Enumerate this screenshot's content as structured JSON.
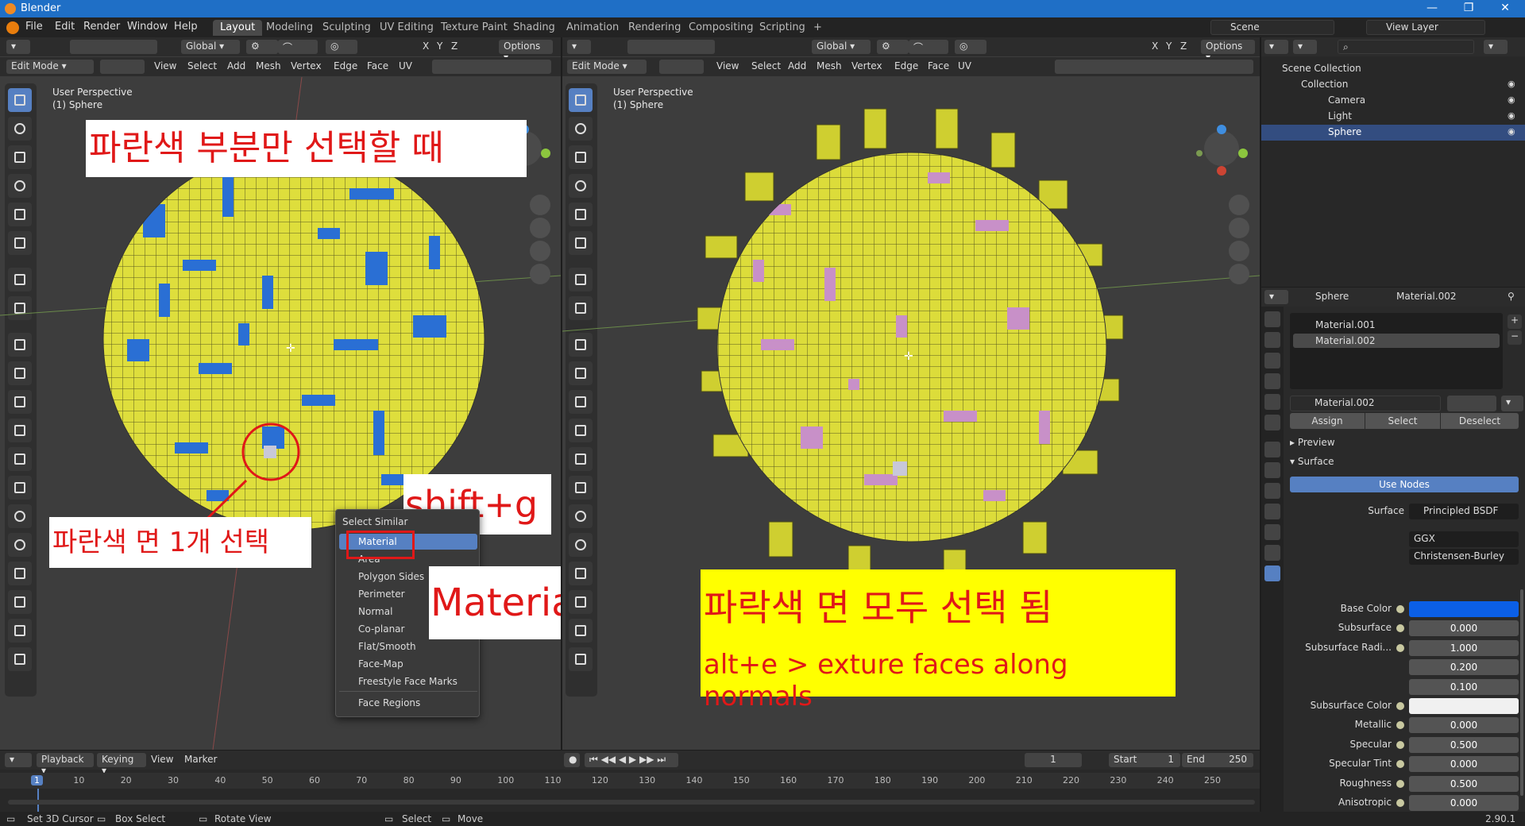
{
  "window": {
    "title": "Blender",
    "min": "—",
    "max": "❐",
    "close": "✕"
  },
  "menu": [
    "File",
    "Edit",
    "Render",
    "Window",
    "Help"
  ],
  "workspaces": [
    "Layout",
    "Modeling",
    "Sculpting",
    "UV Editing",
    "Texture Paint",
    "Shading",
    "Animation",
    "Rendering",
    "Compositing",
    "Scripting",
    "+"
  ],
  "scene": {
    "scene_name": "Scene",
    "view_layer": "View Layer"
  },
  "viewport_header": {
    "orientation": "Global",
    "options": "Options",
    "mode": "Edit Mode",
    "menus": [
      "View",
      "Select",
      "Add",
      "Mesh",
      "Vertex",
      "Edge",
      "Face",
      "UV"
    ],
    "axes": [
      "X",
      "Y",
      "Z"
    ]
  },
  "viewport_left": {
    "perspective": "User Perspective",
    "object": "(1) Sphere"
  },
  "viewport_right": {
    "perspective": "User Perspective",
    "object": "(1) Sphere"
  },
  "annotations": {
    "top_left": "파란색 부분만 선택할 때",
    "bottom_left": "파란색 면 1개 선택",
    "shortcut": "shift+g",
    "material": "Material",
    "result_line1": "파락색 면 모두 선택 됨",
    "result_line2": "alt+e > exture faces along normals"
  },
  "select_similar": {
    "title": "Select Similar",
    "items": [
      "Material",
      "Area",
      "Polygon Sides",
      "Perimeter",
      "Normal",
      "Co-planar",
      "Flat/Smooth",
      "Face-Map",
      "Freestyle Face Marks"
    ],
    "extra": "Face Regions",
    "highlighted": "Material"
  },
  "outliner": {
    "root": "Scene Collection",
    "items": [
      {
        "label": "Collection"
      },
      {
        "label": "Camera"
      },
      {
        "label": "Light"
      },
      {
        "label": "Sphere"
      }
    ]
  },
  "properties": {
    "breadcrumb": [
      "Sphere",
      "Material.002"
    ],
    "slots": [
      "Material.001",
      "Material.002"
    ],
    "material_name": "Material.002",
    "buttons": [
      "Assign",
      "Select",
      "Deselect"
    ],
    "panels": [
      "Preview",
      "Surface"
    ],
    "use_nodes": "Use Nodes",
    "surface_label": "Surface",
    "surface_value": "Principled BSDF",
    "distribution": "GGX",
    "subsurface_method": "Christensen-Burley",
    "rows": [
      {
        "label": "Base Color",
        "value": "",
        "type": "color",
        "color": "#0b5fe6"
      },
      {
        "label": "Subsurface",
        "value": "0.000"
      },
      {
        "label": "Subsurface Radi...",
        "value": "1.000"
      },
      {
        "label": "",
        "value": "0.200"
      },
      {
        "label": "",
        "value": "0.100"
      },
      {
        "label": "Subsurface Color",
        "value": "",
        "type": "color",
        "color": "#f0f0f0"
      },
      {
        "label": "Metallic",
        "value": "0.000"
      },
      {
        "label": "Specular",
        "value": "0.500"
      },
      {
        "label": "Specular Tint",
        "value": "0.000"
      },
      {
        "label": "Roughness",
        "value": "0.500"
      },
      {
        "label": "Anisotropic",
        "value": "0.000"
      }
    ],
    "colors": {
      "accent": "#5680c2"
    }
  },
  "timeline": {
    "menus": [
      "Playback",
      "Keying",
      "View",
      "Marker"
    ],
    "current_frame": "1",
    "start_label": "Start",
    "start": "1",
    "end_label": "End",
    "end": "250",
    "frame_ticks": [
      "1",
      "10",
      "20",
      "30",
      "40",
      "50",
      "60",
      "70",
      "80",
      "90",
      "100",
      "110",
      "120",
      "130",
      "140",
      "150",
      "160",
      "170",
      "180",
      "190",
      "200",
      "210",
      "220",
      "230",
      "240",
      "250"
    ]
  },
  "statusbar": {
    "items": [
      "Set 3D Cursor",
      "Box Select",
      "Rotate View",
      "Select",
      "Move"
    ],
    "version": "2.90.1"
  }
}
